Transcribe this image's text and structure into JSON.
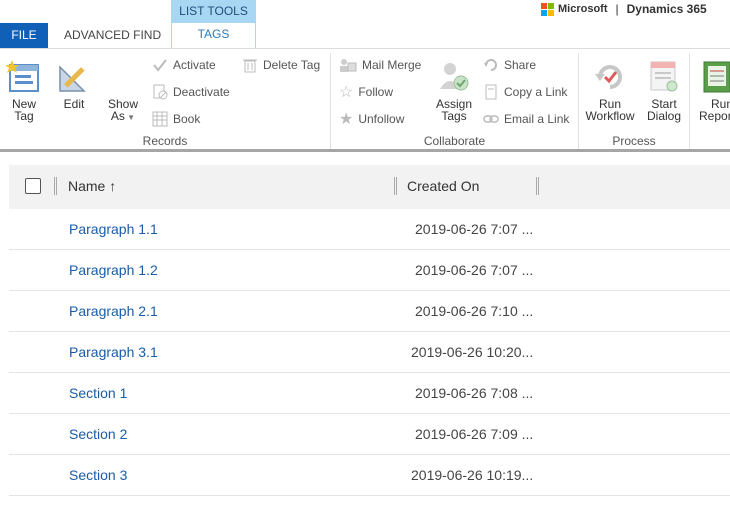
{
  "tabs": {
    "file": "FILE",
    "advanced_find": "ADVANCED FIND",
    "context_group": "LIST TOOLS",
    "context_tab": "TAGS"
  },
  "brand": {
    "microsoft": "Microsoft",
    "separator": "|",
    "product": "Dynamics 365",
    "logo_colors": [
      "#f25022",
      "#7fba00",
      "#00a4ef",
      "#ffb900"
    ]
  },
  "ribbon": {
    "records": {
      "label": "Records",
      "new_tag": [
        "New",
        "Tag"
      ],
      "edit": "Edit",
      "show_as": [
        "Show",
        "As"
      ],
      "activate": "Activate",
      "deactivate": "Deactivate",
      "book": "Book",
      "delete_tag": "Delete Tag"
    },
    "collaborate": {
      "label": "Collaborate",
      "mail_merge": "Mail Merge",
      "follow": "Follow",
      "unfollow": "Unfollow",
      "assign_tags": [
        "Assign",
        "Tags"
      ],
      "share": "Share",
      "copy_link": "Copy a Link",
      "email_link": "Email a Link"
    },
    "process": {
      "label": "Process",
      "run_workflow": [
        "Run",
        "Workflow"
      ],
      "start_dialog": [
        "Start",
        "Dialog"
      ]
    },
    "run_report": [
      "Run",
      "Report"
    ]
  },
  "grid": {
    "columns": {
      "name": "Name",
      "sort_arrow": "↑",
      "created_on": "Created On"
    },
    "rows": [
      {
        "name": "Paragraph 1.1",
        "created_on": "2019-06-26 7:07 ..."
      },
      {
        "name": "Paragraph 1.2",
        "created_on": "2019-06-26 7:07 ..."
      },
      {
        "name": "Paragraph 2.1",
        "created_on": "2019-06-26 7:10 ..."
      },
      {
        "name": "Paragraph 3.1",
        "created_on": "2019-06-26 10:20..."
      },
      {
        "name": "Section 1",
        "created_on": "2019-06-26 7:08 ..."
      },
      {
        "name": "Section 2",
        "created_on": "2019-06-26 7:09 ..."
      },
      {
        "name": "Section 3",
        "created_on": "2019-06-26 10:19..."
      }
    ]
  }
}
